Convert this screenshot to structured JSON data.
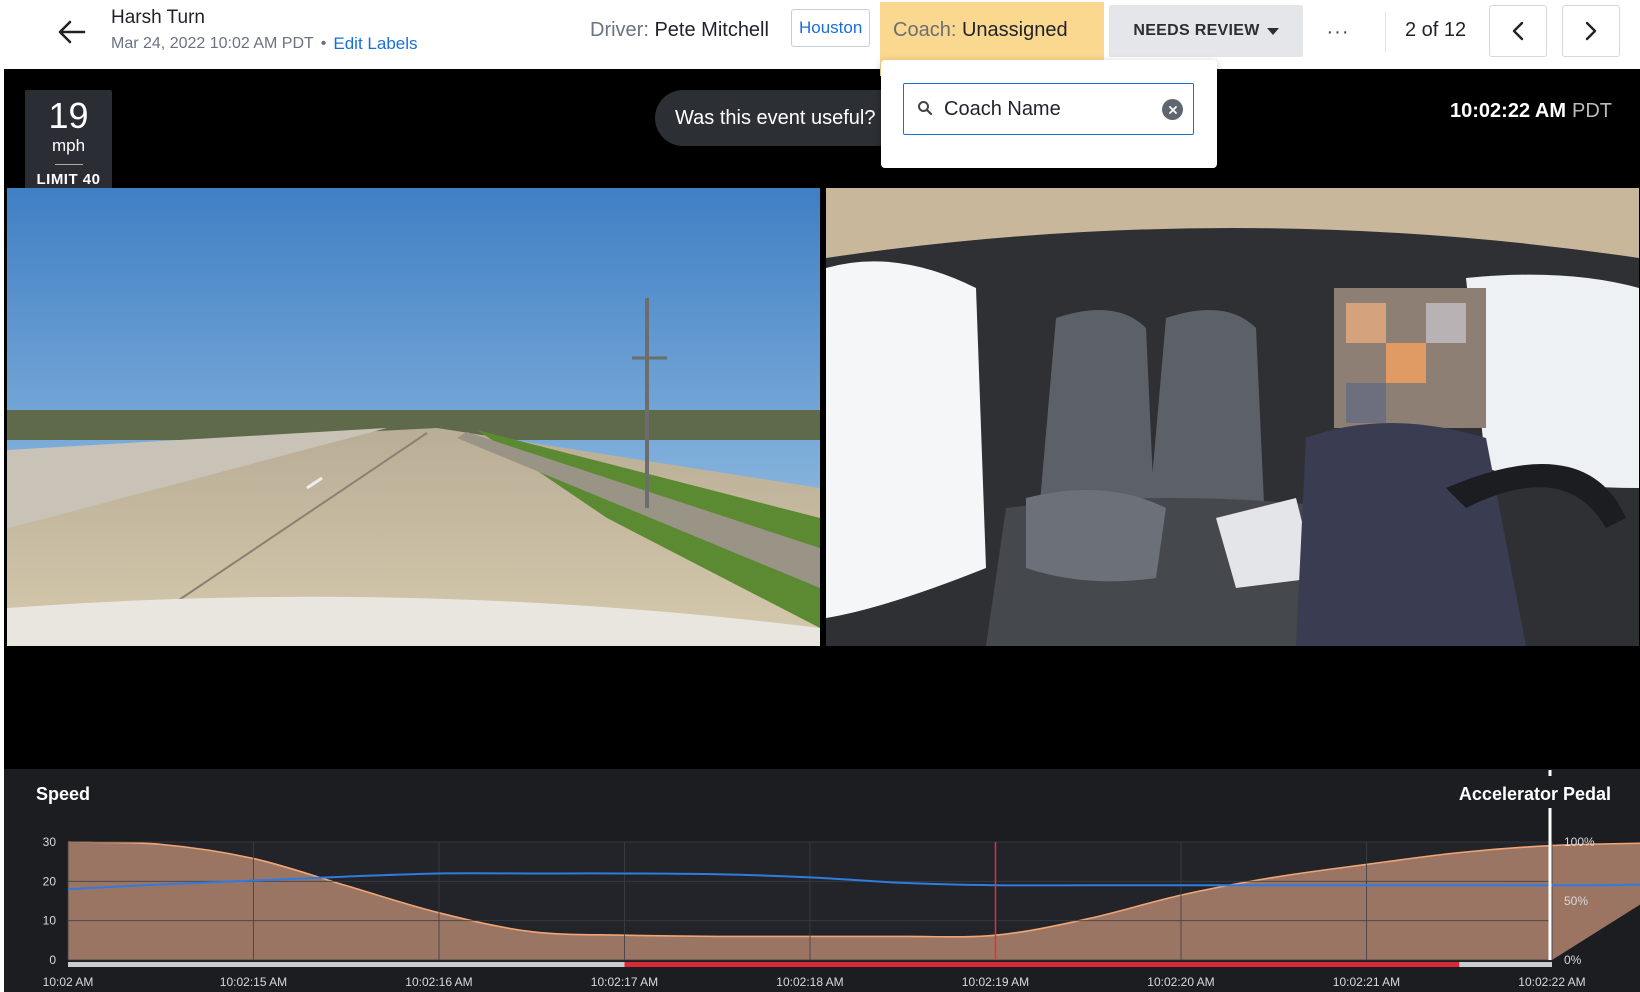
{
  "header": {
    "title": "Harsh Turn",
    "datetime": "Mar 24, 2022 10:02 AM PDT",
    "separator": "•",
    "edit_labels": "Edit Labels",
    "driver_label": "Driver:",
    "driver_name": "Pete Mitchell",
    "tag": "Houston",
    "coach_label": "Coach:",
    "coach_value": "Unassigned",
    "review_status": "NEEDS REVIEW",
    "more": "···",
    "pager": "2 of 12"
  },
  "coach_dropdown": {
    "search_value": "Coach Name"
  },
  "video": {
    "speed": "19",
    "speed_unit": "mph",
    "limit": "LIMIT 40",
    "useful_prompt": "Was this event useful?",
    "time": "10:02:22 AM",
    "timezone": "PDT"
  },
  "chart_data": {
    "type": "area",
    "left_title": "Speed",
    "right_title": "Accelerator Pedal",
    "y_ticks_left": [
      "30",
      "20",
      "10",
      "0"
    ],
    "y_ticks_right": [
      "100%",
      "50%",
      "0%"
    ],
    "x_ticks": [
      "10:02 AM",
      "10:02:15 AM",
      "10:02:16 AM",
      "10:02:17 AM",
      "10:02:18 AM",
      "10:02:19 AM",
      "10:02:20 AM",
      "10:02:21 AM",
      "10:02:22 AM"
    ],
    "ylim_left": [
      0,
      30
    ],
    "ylim_right": [
      0,
      100
    ],
    "series": [
      {
        "name": "Accelerator Pedal",
        "type": "area",
        "color": "#f0a576",
        "t": [
          0,
          0.5,
          1,
          1.5,
          2,
          2.5,
          3,
          3.5,
          4,
          4.5,
          5,
          5.5,
          6,
          6.5,
          7,
          7.5,
          8,
          8.5,
          9
        ],
        "values": [
          100,
          98,
          86,
          63,
          40,
          24,
          21,
          20,
          20,
          20,
          21,
          35,
          55,
          70,
          81,
          91,
          97,
          99,
          99
        ]
      },
      {
        "name": "Speed",
        "type": "line",
        "color": "#2f7be0",
        "t": [
          0,
          0.5,
          1,
          1.5,
          2,
          2.5,
          3,
          3.5,
          4,
          4.5,
          5,
          5.5,
          6,
          6.5,
          7,
          7.5,
          8,
          8.5,
          9
        ],
        "values": [
          18,
          19.2,
          20.2,
          21.2,
          22,
          22,
          22,
          21.8,
          21,
          19.6,
          19,
          19,
          19,
          19,
          19,
          19,
          19,
          19.2,
          20.5
        ]
      }
    ],
    "cursor_t": 5,
    "event_range_t": [
      3,
      7.5
    ],
    "colors": {
      "event": "#d72a36",
      "track": "#c9ccd1",
      "grid": "#3b3e44",
      "cursor": "#e0303a"
    }
  }
}
